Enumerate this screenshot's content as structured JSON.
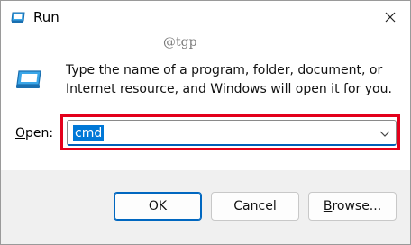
{
  "window": {
    "title": "Run",
    "close_icon": "close-icon",
    "title_icon": "run-app-icon"
  },
  "watermark": "@tgp",
  "description": {
    "icon": "run-app-icon",
    "text": "Type the name of a program, folder, document, or Internet resource, and Windows will open it for you."
  },
  "open": {
    "label_prefix": "",
    "label_mnemonic": "O",
    "label_rest": "pen:",
    "value": "cmd",
    "dropdown_icon": "chevron-down-icon",
    "highlight_color": "#e3001b",
    "selection_color": "#0078d7"
  },
  "buttons": {
    "ok": "OK",
    "cancel": "Cancel",
    "browse_mnemonic": "B",
    "browse_rest": "rowse..."
  }
}
